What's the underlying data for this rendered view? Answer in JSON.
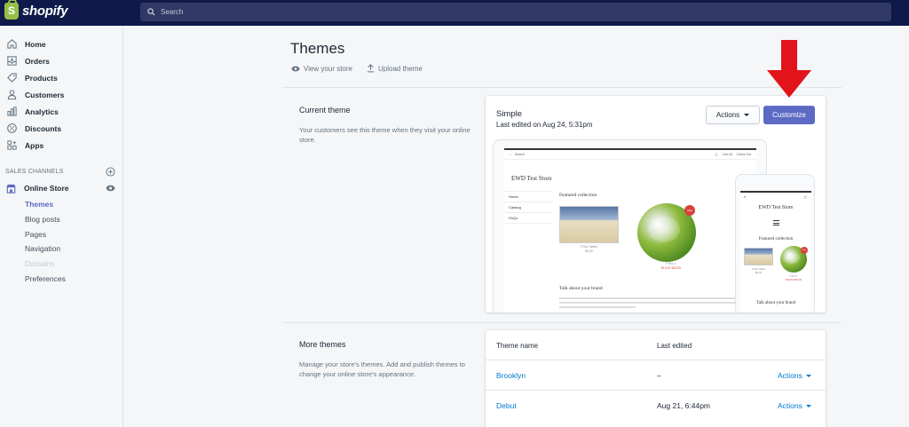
{
  "brand": {
    "name": "shopify",
    "logo_letter": "S"
  },
  "search": {
    "placeholder": "Search"
  },
  "sidebar": {
    "items": [
      {
        "label": "Home",
        "icon": "home-icon"
      },
      {
        "label": "Orders",
        "icon": "orders-icon"
      },
      {
        "label": "Products",
        "icon": "tag-icon"
      },
      {
        "label": "Customers",
        "icon": "person-icon"
      },
      {
        "label": "Analytics",
        "icon": "bar-chart-icon"
      },
      {
        "label": "Discounts",
        "icon": "discount-icon"
      },
      {
        "label": "Apps",
        "icon": "apps-icon"
      }
    ],
    "channels_header": "SALES CHANNELS",
    "online_store": "Online Store",
    "subitems": [
      {
        "label": "Themes",
        "state": "active"
      },
      {
        "label": "Blog posts",
        "state": "normal"
      },
      {
        "label": "Pages",
        "state": "normal"
      },
      {
        "label": "Navigation",
        "state": "normal"
      },
      {
        "label": "Domains",
        "state": "disabled"
      },
      {
        "label": "Preferences",
        "state": "normal"
      }
    ]
  },
  "page": {
    "title": "Themes",
    "view_store": "View your store",
    "upload_theme": "Upload theme"
  },
  "current": {
    "section_title": "Current theme",
    "section_desc": "Your customers see this theme when they visit your online store.",
    "theme_name": "Simple",
    "last_edited": "Last edited on Aug 24, 5:31pm",
    "actions_label": "Actions",
    "customize_label": "Customize"
  },
  "preview": {
    "search_text": "Search",
    "cart_text": "Cart (0)",
    "checkout_text": "Check Out",
    "store_name": "EWD Test Store",
    "menu": [
      "Home",
      "Catalog",
      "FAQs"
    ],
    "featured": "Featured collection",
    "product1_name": "FYAL Tablet",
    "product1_price": "$9.00",
    "sale_badge": "Sale",
    "product2_name": "FYAL 1",
    "product2_price": "$19.00 $29.00",
    "talk": "Talk about your brand",
    "talk_text": "Use this text to share information about your brand with your customers. Describe a product, share announcements, or welcome customers to your store."
  },
  "more": {
    "section_title": "More themes",
    "section_desc": "Manage your store's themes. Add and publish themes to change your online store's appearance.",
    "col_name": "Theme name",
    "col_edited": "Last edited",
    "rows": [
      {
        "name": "Brooklyn",
        "edited": "–",
        "actions": "Actions"
      },
      {
        "name": "Debut",
        "edited": "Aug 21, 6:44pm",
        "actions": "Actions"
      }
    ]
  },
  "colors": {
    "topbar": "#0f1a4a",
    "accent": "#5c6ac4",
    "link": "#007ace",
    "annotation_arrow": "#e3131b"
  }
}
